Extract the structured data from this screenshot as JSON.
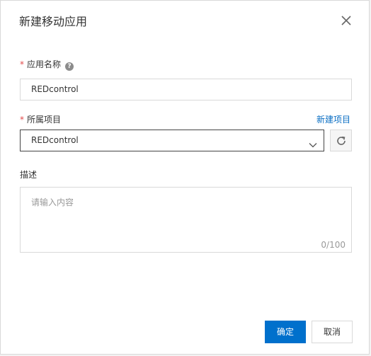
{
  "dialog": {
    "title": "新建移动应用",
    "close_icon": "close-icon"
  },
  "form": {
    "required_mark": "*",
    "app_name": {
      "label": "应用名称",
      "help_icon": "question-circle-icon",
      "value": "REDcontrol"
    },
    "project": {
      "label": "所属项目",
      "new_link": "新建项目",
      "selected": "REDcontrol",
      "dropdown_icon": "chevron-down-icon",
      "refresh_icon": "refresh-icon"
    },
    "description": {
      "label": "描述",
      "placeholder": "请输入内容",
      "counter": "0/100"
    }
  },
  "footer": {
    "confirm_label": "确定",
    "cancel_label": "取消"
  },
  "colors": {
    "primary": "#0070cc",
    "link": "#0b6fc4",
    "required": "#e24b4b"
  }
}
